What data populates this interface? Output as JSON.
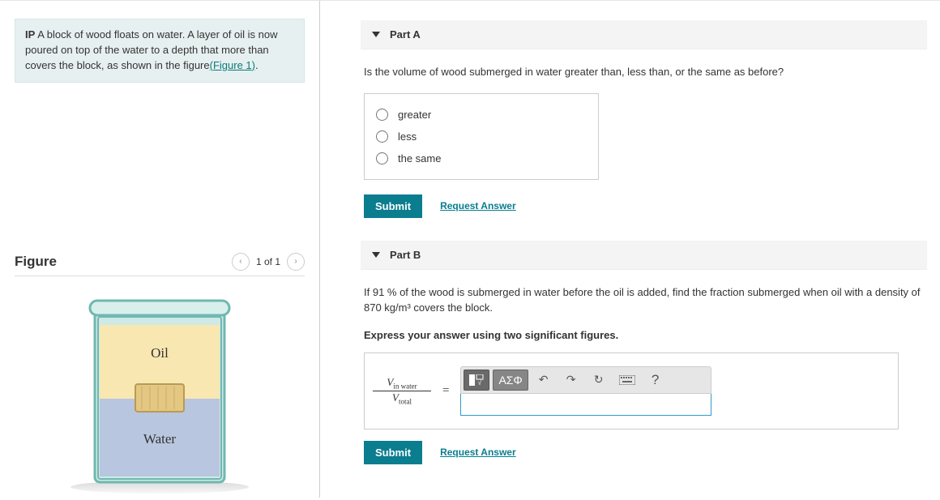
{
  "problem": {
    "prefix": "IP",
    "text": " A block of wood floats on water. A layer of oil is now poured on top of the water to a depth that more than covers the block, as shown in the figure",
    "figure_link": "(Figure 1)",
    "suffix": "."
  },
  "figure": {
    "heading": "Figure",
    "pager_current": "1 of 1",
    "label_oil": "Oil",
    "label_water": "Water"
  },
  "partA": {
    "title": "Part A",
    "question": "Is the volume of wood submerged in water greater than, less than, or the same as before?",
    "choices": [
      "greater",
      "less",
      "the same"
    ],
    "submit": "Submit",
    "request": "Request Answer"
  },
  "partB": {
    "title": "Part B",
    "question": "If 91 % of the wood is submerged in water before the oil is added, find the fraction submerged when oil with a density of 870 kg/m³ covers the block.",
    "hint": "Express your answer using two significant figures.",
    "answer_label_num": "Vin water",
    "answer_label_den": "Vtotal",
    "equals": "=",
    "submit": "Submit",
    "request": "Request Answer",
    "tool_greek": "ΑΣΦ",
    "tool_help": "?"
  }
}
